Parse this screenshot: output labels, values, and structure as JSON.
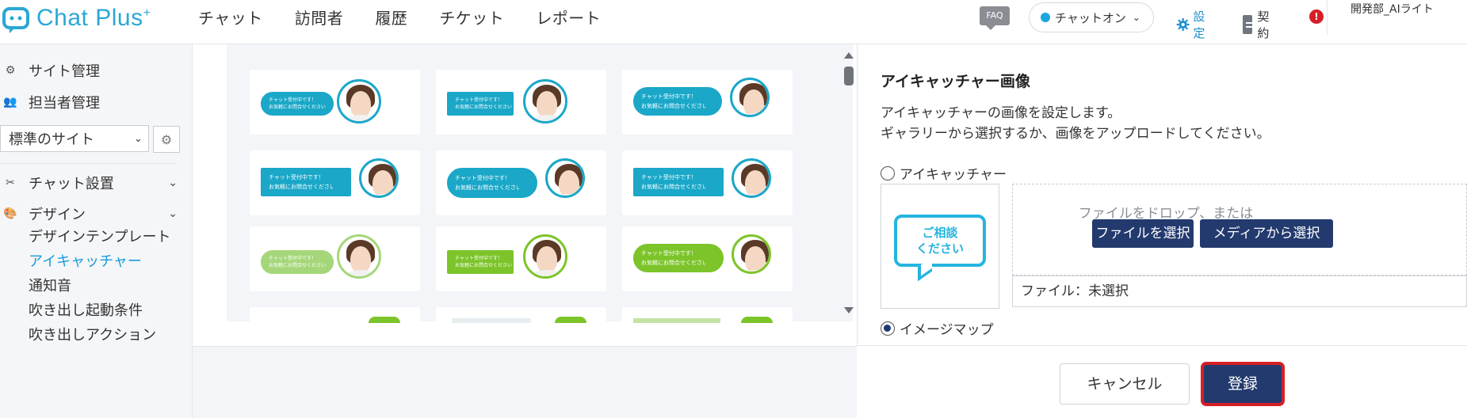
{
  "header": {
    "logo_text": "Chat Plus",
    "logo_plus": "+",
    "nav": [
      "チャット",
      "訪問者",
      "履歴",
      "チケット",
      "レポート"
    ],
    "faq": "FAQ",
    "status": "チャットオン",
    "settings": "設定",
    "contract": "契約",
    "alert": "!",
    "user": "開発部_AIライト"
  },
  "sidebar": {
    "site_management": "サイト管理",
    "staff_management": "担当者管理",
    "site_select": "標準のサイト",
    "chat_setup": "チャット設置",
    "design": "デザイン",
    "sub_items": [
      "デザインテンプレート",
      "アイキャッチャー",
      "通知音",
      "吹き出し起動条件",
      "吹き出しアクション"
    ],
    "active_sub": "アイキャッチャー"
  },
  "gallery": {
    "bubble_line1": "チャット受付中です！",
    "bubble_line2": "お気軽にお問合せください",
    "colors": {
      "row1": "#1aa7c8",
      "row2": "#1aa7c8",
      "row3_faded": "#a5d77a",
      "row3": "#7cc42a"
    }
  },
  "panel": {
    "title": "アイキャッチャー画像",
    "desc_line1": "アイキャッチャーの画像を設定します。",
    "desc_line2": "ギャラリーから選択するか、画像をアップロードしてください。",
    "radio_eyecatcher": "アイキャッチャー",
    "preview_line1": "ご相談",
    "preview_line2": "ください",
    "drop_text": "ファイルをドロップ、または",
    "choose_file": "ファイルを選択",
    "choose_media": "メディアから選択",
    "file_status": "ファイル：未選択",
    "radio_imagemap": "イメージマップ",
    "cancel": "キャンセル",
    "register": "登録"
  }
}
